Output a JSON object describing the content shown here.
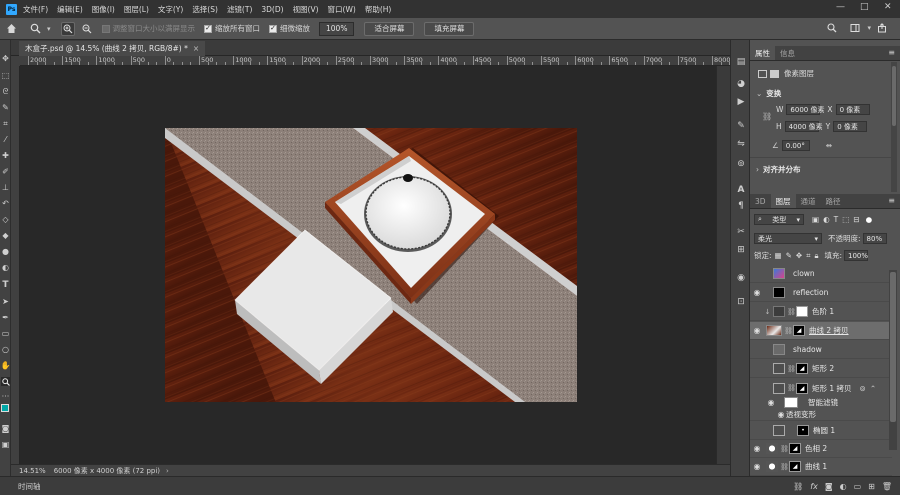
{
  "app": {
    "logo": "Ps",
    "menu": [
      "文件(F)",
      "编辑(E)",
      "图像(I)",
      "图层(L)",
      "文字(Y)",
      "选择(S)",
      "滤镜(T)",
      "3D(D)",
      "视图(V)",
      "窗口(W)",
      "帮助(H)"
    ],
    "window_controls": [
      "—",
      "□",
      "✕"
    ]
  },
  "options_bar": {
    "home_icon": "home-icon",
    "zoom_tool_icon": "magnifier-icon",
    "resize_windows": {
      "label": "调整窗口大小以满屏显示",
      "checked": false,
      "enabled": false
    },
    "zoom_all": {
      "label": "缩放所有窗口",
      "checked": true
    },
    "scrubby_zoom": {
      "label": "细微缩放",
      "checked": true
    },
    "zoom_value": "100%",
    "fit_screen": "适合屏幕",
    "fill_screen": "填充屏幕"
  },
  "document": {
    "tab_title": "木盒子.psd @ 14.5% (曲线 2 拷贝, RGB/8#) *",
    "ruler_labels": [
      "2000",
      "1500",
      "1000",
      "500",
      "0",
      "500",
      "1000",
      "1500",
      "2000",
      "2500",
      "3000",
      "3500",
      "4000",
      "4500",
      "5000",
      "5500",
      "6000",
      "6500",
      "7000",
      "7500",
      "8000"
    ],
    "zoom_status": "14.51%",
    "size_status": "6000 像素 x 4000 像素 (72 ppi)"
  },
  "timeline": {
    "label": "时间轴"
  },
  "properties_panel": {
    "tabs": [
      "属性",
      "信息"
    ],
    "kind_label": "像素图层",
    "transform_title": "变换",
    "w_label": "W",
    "w_value": "6000 像素",
    "h_label": "H",
    "h_value": "4000 像素",
    "x_label": "X",
    "x_value": "0 像素",
    "y_label": "Y",
    "y_value": "0 像素",
    "angle_value": "0.00°",
    "align_title": "对齐并分布"
  },
  "layers_panel": {
    "tabs": [
      "3D",
      "图层",
      "通道",
      "路径"
    ],
    "filter_kind": "类型",
    "blend_mode": "柔光",
    "opacity_label": "不透明度:",
    "opacity_value": "80%",
    "lock_label": "锁定:",
    "fill_label": "填充:",
    "fill_value": "100%",
    "layers": [
      {
        "name": "clown",
        "visible": false
      },
      {
        "name": "reflection",
        "visible": true
      },
      {
        "name": "色阶 1",
        "visible": false
      },
      {
        "name": "曲线 2 拷贝",
        "visible": true
      },
      {
        "name": "shadow",
        "visible": false
      },
      {
        "name": "矩形 2",
        "visible": false
      },
      {
        "name": "矩形 1 拷贝",
        "visible": false
      },
      {
        "name": "智能滤镜",
        "visible": true
      },
      {
        "name": "透视变形",
        "visible": true
      },
      {
        "name": "椭圆 1",
        "visible": false
      },
      {
        "name": "色相 2",
        "visible": true
      },
      {
        "name": "曲线 1",
        "visible": true
      }
    ]
  },
  "colors": {
    "accent": "#31a8ff",
    "foreground_swatch": "#00a8a8",
    "background_swatch": "#ffffff"
  }
}
